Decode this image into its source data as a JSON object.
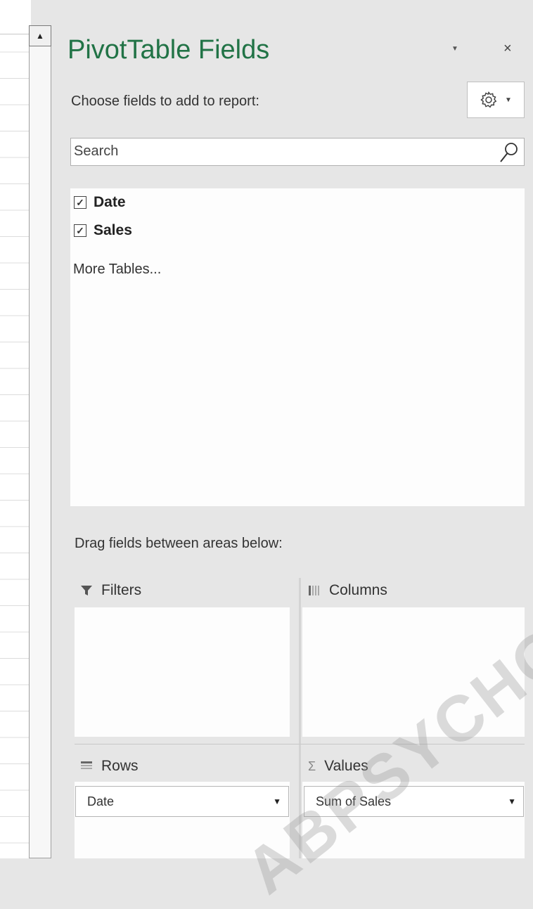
{
  "panel": {
    "title": "PivotTable Fields",
    "choose_label": "Choose fields to add to report:",
    "close_symbol": "×",
    "tools_icon": "gear-icon"
  },
  "search": {
    "placeholder": "Search",
    "value": ""
  },
  "field_list": {
    "fields": [
      {
        "label": "Date",
        "checked": true
      },
      {
        "label": "Sales",
        "checked": true
      }
    ],
    "more_tables": "More Tables..."
  },
  "areas": {
    "instruction": "Drag fields between areas below:",
    "filters": {
      "label": "Filters",
      "items": []
    },
    "columns": {
      "label": "Columns",
      "items": []
    },
    "rows": {
      "label": "Rows",
      "items": [
        "Date"
      ]
    },
    "values": {
      "label": "Values",
      "items": [
        "Sum of Sales"
      ]
    }
  },
  "watermark": "ABPSYCHOL",
  "colors": {
    "title": "#217346",
    "panel_bg": "#e6e6e6",
    "box_bg": "#fdfdfd"
  }
}
